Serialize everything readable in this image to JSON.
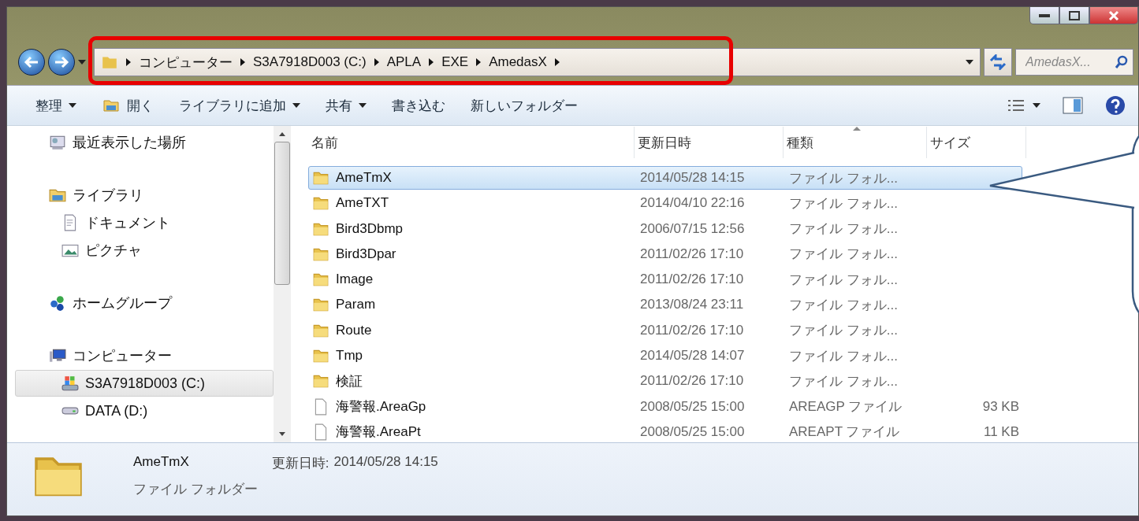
{
  "address_bar": {
    "crumbs": [
      "コンピューター",
      "S3A7918D003 (C:)",
      "APLA",
      "EXE",
      "AmedasX"
    ]
  },
  "search": {
    "placeholder": "AmedasX..."
  },
  "toolbar": {
    "items": [
      {
        "label": "整理",
        "kind": "menu"
      },
      {
        "label": "開く",
        "kind": "icon"
      },
      {
        "label": "ライブラリに追加",
        "kind": "menu"
      },
      {
        "label": "共有",
        "kind": "menu"
      },
      {
        "label": "書き込む",
        "kind": "plain"
      },
      {
        "label": "新しいフォルダー",
        "kind": "plain"
      }
    ]
  },
  "sidebar": {
    "items": [
      {
        "label": "最近表示した場所",
        "kind": "recent",
        "selected": false
      },
      {
        "label": "ライブラリ",
        "kind": "library",
        "selected": false,
        "children": [
          {
            "label": "ドキュメント",
            "kind": "document",
            "selected": false
          },
          {
            "label": "ピクチャ",
            "kind": "picture",
            "selected": false
          }
        ]
      },
      {
        "label": "ホームグループ",
        "kind": "homegroup",
        "selected": false
      },
      {
        "label": "コンピューター",
        "kind": "computer",
        "selected": false,
        "children": [
          {
            "label": "S3A7918D003 (C:)",
            "kind": "system-drive",
            "selected": true
          },
          {
            "label": "DATA (D:)",
            "kind": "drive",
            "selected": false
          }
        ]
      }
    ]
  },
  "file_list": {
    "columns": [
      "名前",
      "更新日時",
      "種類",
      "サイズ"
    ],
    "rows": [
      {
        "name": "AmeTmX",
        "modified": "2014/05/28 14:15",
        "type": "ファイル フォル...",
        "kind": "folder",
        "selected": true
      },
      {
        "name": "AmeTXT",
        "modified": "2014/04/10 22:16",
        "type": "ファイル フォル...",
        "kind": "folder",
        "selected": false
      },
      {
        "name": "Bird3Dbmp",
        "modified": "2006/07/15 12:56",
        "type": "ファイル フォル...",
        "kind": "folder",
        "selected": false
      },
      {
        "name": "Bird3Dpar",
        "modified": "2011/02/26 17:10",
        "type": "ファイル フォル...",
        "kind": "folder",
        "selected": false
      },
      {
        "name": "Image",
        "modified": "2011/02/26 17:10",
        "type": "ファイル フォル...",
        "kind": "folder",
        "selected": false
      },
      {
        "name": "Param",
        "modified": "2013/08/24 23:11",
        "type": "ファイル フォル...",
        "kind": "folder",
        "selected": false
      },
      {
        "name": "Route",
        "modified": "2011/02/26 17:10",
        "type": "ファイル フォル...",
        "kind": "folder",
        "selected": false
      },
      {
        "name": "Tmp",
        "modified": "2014/05/28 14:07",
        "type": "ファイル フォル...",
        "kind": "folder",
        "selected": false
      },
      {
        "name": "検証",
        "modified": "2011/02/26 17:10",
        "type": "ファイル フォル...",
        "kind": "folder",
        "selected": false
      },
      {
        "name": "海警報.AreaGp",
        "modified": "2008/05/25 15:00",
        "type": "AREAGP ファイル",
        "size": "93 KB",
        "kind": "file",
        "selected": false
      },
      {
        "name": "海警報.AreaPt",
        "modified": "2008/05/25 15:00",
        "type": "AREAPT ファイル",
        "size": "11 KB",
        "kind": "file",
        "selected": false
      }
    ]
  },
  "details_pane": {
    "name": "AmeTmX",
    "type": "ファイル フォルダー",
    "modified_label": "更新日時:",
    "modified": "2014/05/28 14:15"
  }
}
